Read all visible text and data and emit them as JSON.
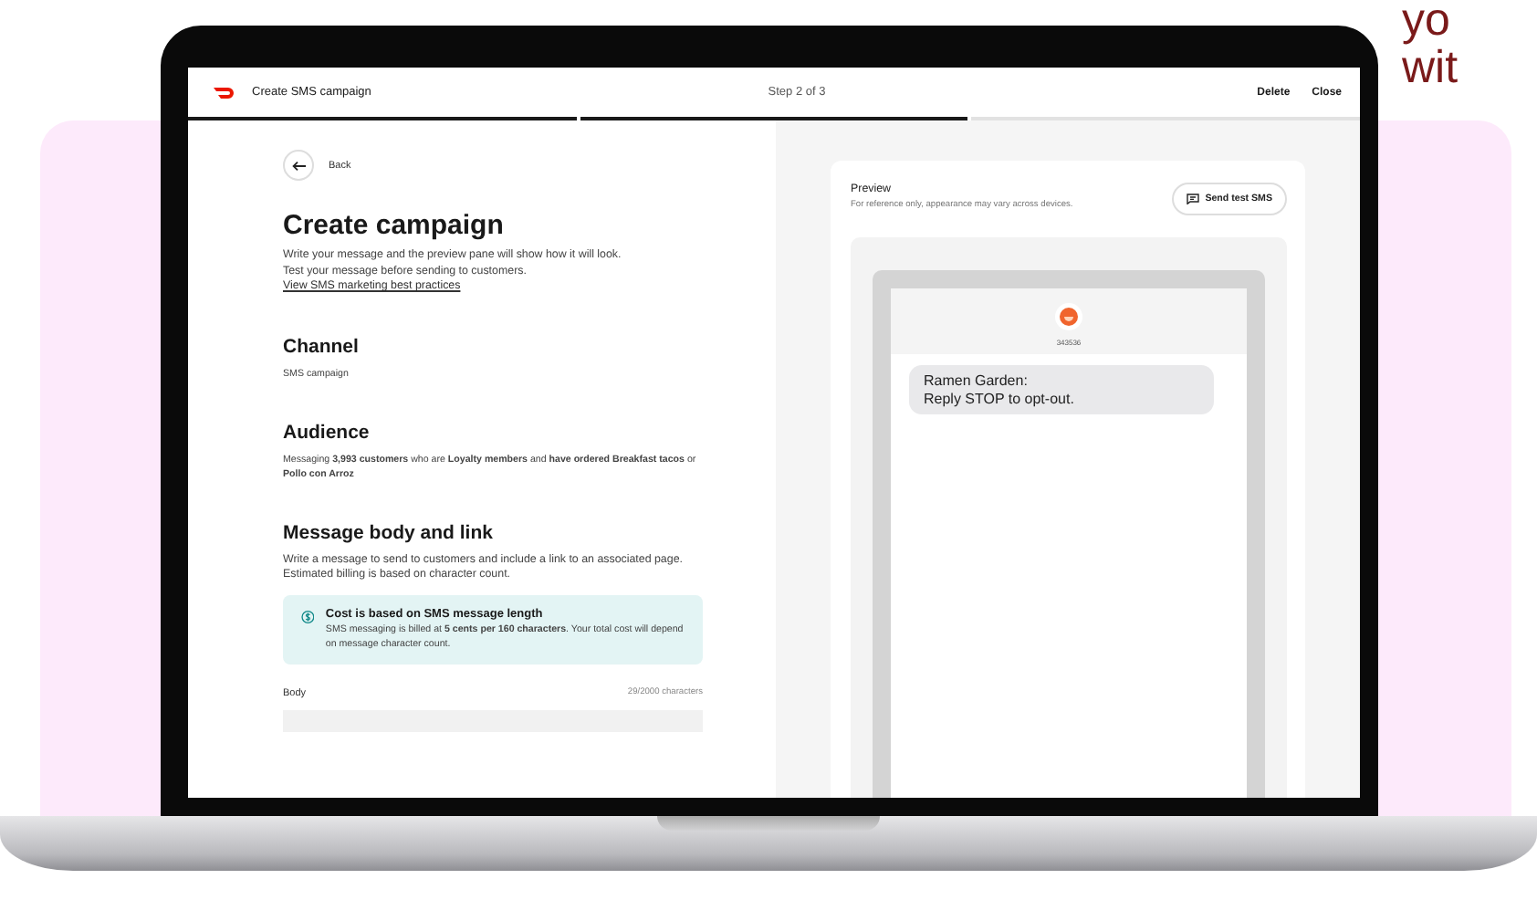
{
  "background_text": [
    "yo",
    "wit"
  ],
  "header": {
    "title": "Create SMS campaign",
    "step": "Step 2 of 3",
    "actions": [
      "Delete",
      "Close"
    ]
  },
  "progress": [
    {
      "done": true
    },
    {
      "done": true
    },
    {
      "done": false
    }
  ],
  "back": "Back",
  "page_title": "Create campaign",
  "intro": [
    "Write your message and the preview pane will show how it will look.",
    "Test your message before sending to customers."
  ],
  "intro_link": "View SMS marketing best practices",
  "sections": [
    {
      "heading": "Channel",
      "text": "SMS campaign"
    },
    {
      "heading": "Audience",
      "text": "Messaging **3,993 customers** who are **Loyalty members** and **have ordered Breakfast tacos** or **Pollo con Arroz**"
    },
    {
      "heading": "Message body and link",
      "text": "Write a message to send to customers and include a link to an associated page. Estimated billing is based on character count."
    }
  ],
  "notice": {
    "title": "Cost is based on SMS message length",
    "text": "SMS messaging is billed at **5 cents per 160 characters**. Your total cost will depend on message character count."
  },
  "body_field": {
    "label": "Body",
    "counter": "29/2000 characters"
  },
  "preview": {
    "title": "Preview",
    "subtitle": "For reference only, appearance may vary across devices.",
    "button": "Send test SMS",
    "sender": "343536",
    "message": [
      "Ramen Garden:",
      "Reply STOP to opt-out."
    ]
  }
}
